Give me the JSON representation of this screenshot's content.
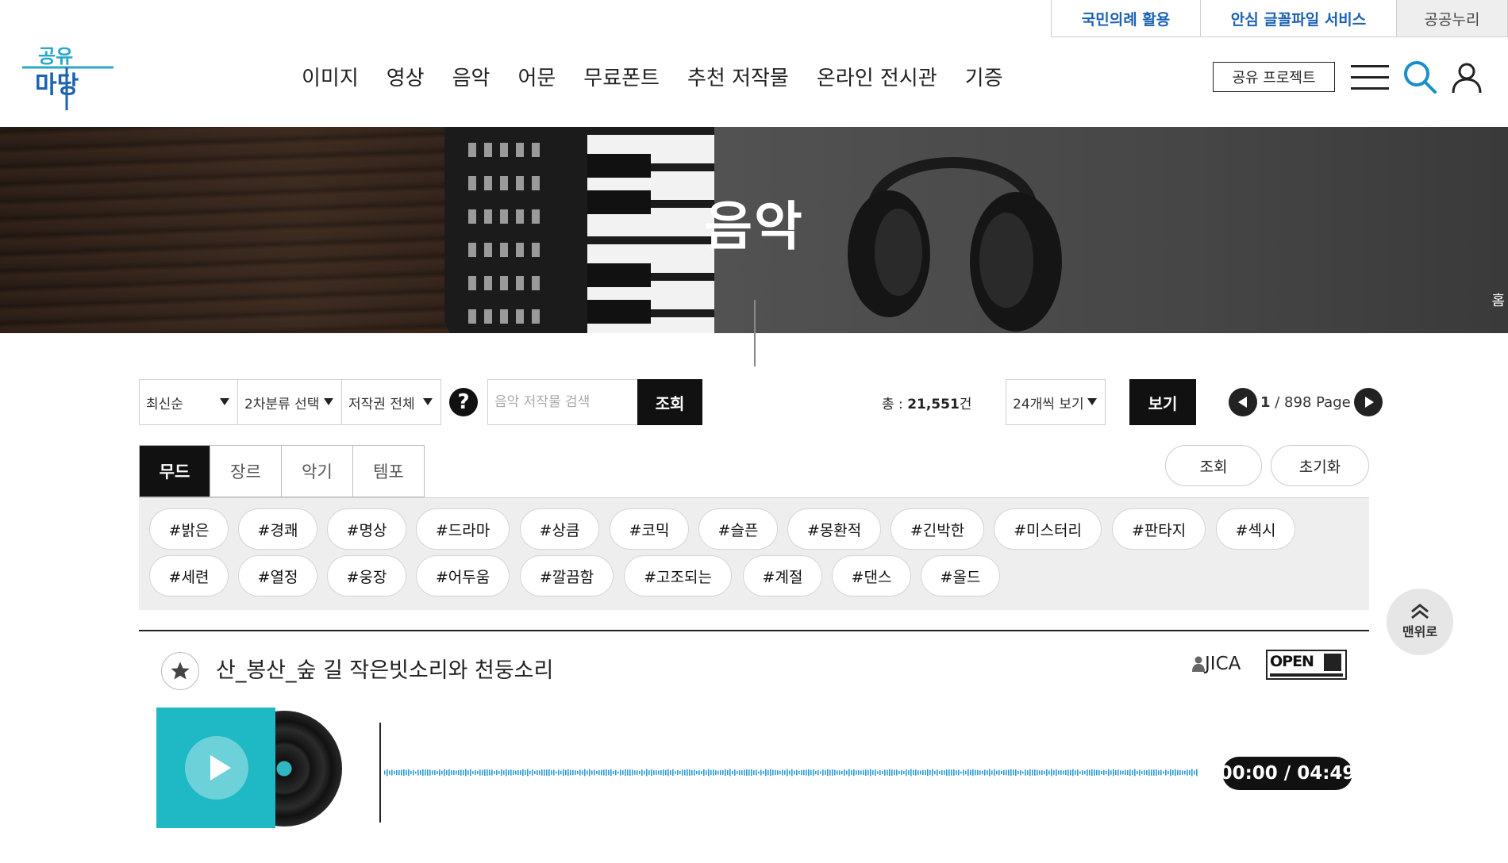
{
  "utility_links": [
    "국민의례 활용",
    "안심 글꼴파일 서비스",
    "공공누리"
  ],
  "logo": {
    "text": "공유마당",
    "colors": [
      "#2aa7c9",
      "#1b62b3"
    ]
  },
  "gnb": [
    "이미지",
    "영상",
    "음악",
    "어문",
    "무료폰트",
    "추천 저작물",
    "온라인 전시관",
    "기증"
  ],
  "header": {
    "share_label": "공유 프로젝트",
    "icons": [
      "menu-icon",
      "search-icon",
      "user-icon"
    ]
  },
  "banner": {
    "title": "음악",
    "home_label": "홈"
  },
  "filters": {
    "sort": "최신순",
    "category": "2차분류 선택",
    "copyright": "저작권 전체",
    "help": "?",
    "search_placeholder": "음악 저작물 검색",
    "search_button": "조회",
    "total_prefix": "총 : ",
    "total_count": "21,551",
    "total_unit": "건",
    "per_page": "24개씩 보기",
    "view_button": "보기",
    "page_current": "1",
    "page_total": " / 898 Page"
  },
  "tag_tabs": [
    "무드",
    "장르",
    "악기",
    "템포"
  ],
  "tag_actions": {
    "search": "조회",
    "reset": "초기화"
  },
  "tags": [
    "#밝은",
    "#경쾌",
    "#명상",
    "#드라마",
    "#상큼",
    "#코믹",
    "#슬픈",
    "#몽환적",
    "#긴박한",
    "#미스터리",
    "#판타지",
    "#섹시",
    "#세련",
    "#열정",
    "#웅장",
    "#어두움",
    "#깔끔함",
    "#고조되는",
    "#계절",
    "#댄스",
    "#올드"
  ],
  "back_to_top": "맨위로",
  "item": {
    "title": "산_봉산_숲 길 작은빗소리와 천둥소리",
    "author": "JICA",
    "license": "OPEN",
    "time": "00:00 / 04:49",
    "accent": "#1fb9c5",
    "wave_color": "#2d9bd6"
  }
}
